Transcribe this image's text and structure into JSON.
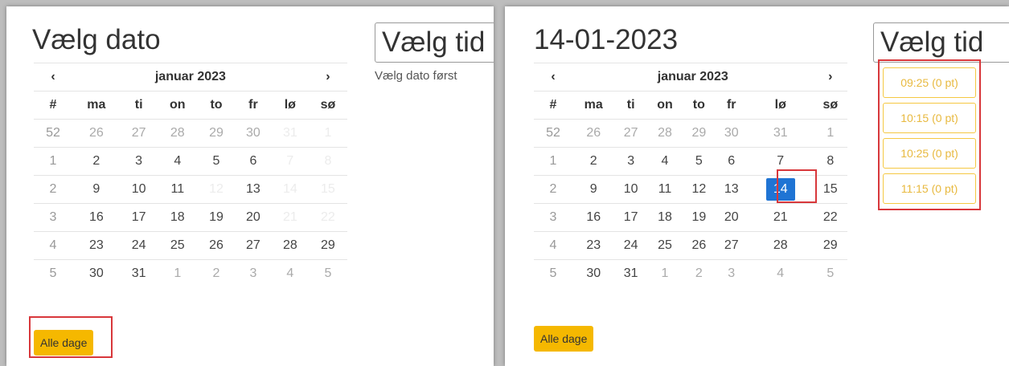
{
  "left": {
    "heading": "Vælg dato",
    "time_label": "Vælg tid",
    "time_hint": "Vælg dato først",
    "button": "Alle dage"
  },
  "right": {
    "heading": "14-01-2023",
    "time_label": "Vælg tid",
    "button": "Alle dage",
    "slots": [
      "09:25 (0 pt)",
      "10:15 (0 pt)",
      "10:25 (0 pt)",
      "11:15 (0 pt)"
    ]
  },
  "calendar": {
    "month": "januar 2023",
    "prev": "‹",
    "next": "›",
    "headers": [
      "#",
      "ma",
      "ti",
      "on",
      "to",
      "fr",
      "lø",
      "sø"
    ],
    "weeks": [
      {
        "num": "52",
        "days": [
          "26",
          "27",
          "28",
          "29",
          "30",
          "31",
          "1"
        ]
      },
      {
        "num": "1",
        "days": [
          "2",
          "3",
          "4",
          "5",
          "6",
          "7",
          "8"
        ]
      },
      {
        "num": "2",
        "days": [
          "9",
          "10",
          "11",
          "12",
          "13",
          "14",
          "15"
        ]
      },
      {
        "num": "3",
        "days": [
          "16",
          "17",
          "18",
          "19",
          "20",
          "21",
          "22"
        ]
      },
      {
        "num": "4",
        "days": [
          "23",
          "24",
          "25",
          "26",
          "27",
          "28",
          "29"
        ]
      },
      {
        "num": "5",
        "days": [
          "30",
          "31",
          "1",
          "2",
          "3",
          "4",
          "5"
        ]
      }
    ]
  },
  "left_day_state": [
    [
      "o",
      "o",
      "o",
      "o",
      "o",
      "d",
      "d"
    ],
    [
      "n",
      "n",
      "n",
      "n",
      "n",
      "d",
      "d"
    ],
    [
      "n",
      "n",
      "n",
      "d",
      "n",
      "d",
      "d"
    ],
    [
      "n",
      "n",
      "n",
      "n",
      "n",
      "d",
      "d"
    ],
    [
      "n",
      "n",
      "n",
      "n",
      "n",
      "n",
      "n"
    ],
    [
      "n",
      "n",
      "o",
      "o",
      "o",
      "o",
      "o"
    ]
  ],
  "right_day_state": [
    [
      "o",
      "o",
      "o",
      "o",
      "o",
      "o",
      "o"
    ],
    [
      "n",
      "n",
      "n",
      "n",
      "n",
      "n",
      "n"
    ],
    [
      "n",
      "n",
      "n",
      "n",
      "n",
      "s",
      "n"
    ],
    [
      "n",
      "n",
      "n",
      "n",
      "n",
      "n",
      "n"
    ],
    [
      "n",
      "n",
      "n",
      "n",
      "n",
      "n",
      "n"
    ],
    [
      "n",
      "n",
      "o",
      "o",
      "o",
      "o",
      "o"
    ]
  ],
  "colors": {
    "accent": "#f5b800",
    "selected": "#1f74d4",
    "highlight": "#d8373b",
    "slot_text": "#e8b93f"
  }
}
